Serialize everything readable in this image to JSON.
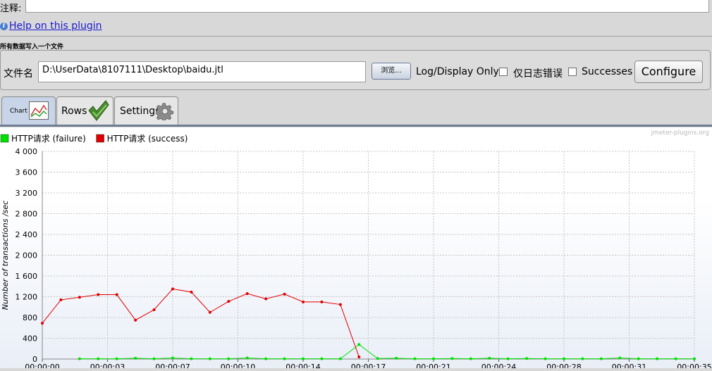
{
  "comment_label": "注释:",
  "help_link": "Help on this plugin",
  "section_title": "所有数据写入一个文件",
  "file": {
    "label": "文件名",
    "value": "D:\\UserData\\8107111\\Desktop\\baidu.jtl",
    "browse_label": "浏览...",
    "log_display_label": "Log/Display Only:",
    "errors_label": "仅日志错误",
    "successes_label": "Successes",
    "configure_label": "Configure"
  },
  "tabs": [
    {
      "label": "Chart"
    },
    {
      "label": "Rows"
    },
    {
      "label": "Settings"
    }
  ],
  "watermark": "jmeter-plugins.org",
  "chart_data": {
    "type": "line",
    "ylabel": "Number of transactions /sec",
    "ylim": [
      0,
      4000
    ],
    "y_ticks": [
      "0",
      "400",
      "800",
      "1 200",
      "1 600",
      "2 000",
      "2 400",
      "2 800",
      "3 200",
      "3 600",
      "4 000"
    ],
    "x_ticks": [
      "00:00:00",
      "00:00:03",
      "00:00:07",
      "00:00:10",
      "00:00:14",
      "00:00:17",
      "00:00:21",
      "00:00:24",
      "00:00:28",
      "00:00:31",
      "00:00:35"
    ],
    "xlim": [
      0,
      35
    ],
    "grid": true,
    "legend_position": "top-left",
    "series": [
      {
        "name": "HTTP请求 (failure)",
        "color": "#00e000",
        "x": [
          2,
          3,
          4,
          5,
          6,
          7,
          8,
          9,
          10,
          11,
          12,
          13,
          14,
          15,
          16,
          17,
          18,
          19,
          20,
          21,
          22,
          23,
          24,
          25,
          26,
          27,
          28,
          29,
          30,
          31,
          32,
          33,
          34,
          35
        ],
        "y": [
          5,
          5,
          5,
          15,
          5,
          20,
          5,
          5,
          5,
          20,
          5,
          5,
          5,
          5,
          5,
          280,
          10,
          15,
          5,
          5,
          10,
          5,
          15,
          5,
          10,
          5,
          5,
          5,
          5,
          20,
          5,
          5,
          5,
          5
        ]
      },
      {
        "name": "HTTP请求 (success)",
        "color": "#e00000",
        "x": [
          0,
          1,
          2,
          3,
          4,
          5,
          6,
          7,
          8,
          9,
          10,
          11,
          12,
          13,
          14,
          15,
          16,
          17
        ],
        "y": [
          690,
          1140,
          1190,
          1240,
          1240,
          750,
          950,
          1350,
          1290,
          900,
          1110,
          1260,
          1160,
          1250,
          1100,
          1100,
          1050,
          40
        ]
      }
    ]
  }
}
